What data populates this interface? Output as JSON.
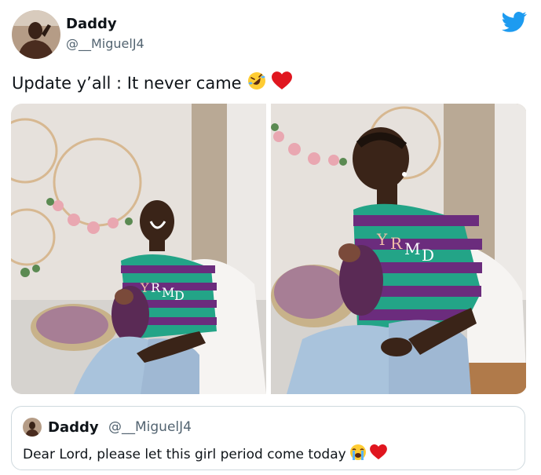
{
  "author": {
    "display_name": "Daddy",
    "handle": "@__MiguelJ4"
  },
  "tweet": {
    "text": "Update y’all : It never came",
    "emojis": [
      "rolling-on-floor-laughing-icon",
      "red-heart-icon"
    ]
  },
  "media": {
    "photos": [
      {
        "shirt_text": "YRMD"
      },
      {
        "shirt_text": "YRMD"
      }
    ]
  },
  "quoted_tweet": {
    "display_name": "Daddy",
    "handle": "@__MiguelJ4",
    "text": "Dear Lord, please let this girl period come today",
    "emojis": [
      "loudly-crying-face-icon",
      "red-heart-icon"
    ]
  },
  "colors": {
    "twitter_blue": "#1d9bf0",
    "heart_red": "#e0161f",
    "handle_gray": "#536471",
    "shirt_green": "#23a487",
    "shirt_purple": "#6b2c7d"
  }
}
